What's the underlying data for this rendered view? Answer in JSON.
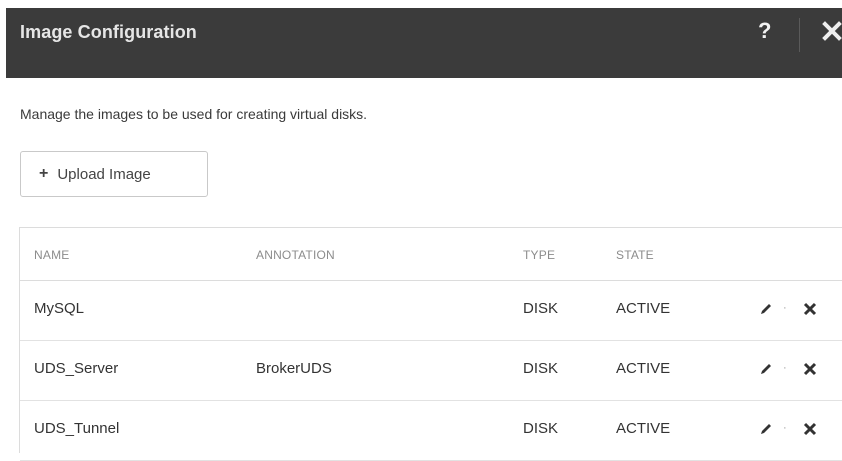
{
  "dialog": {
    "title": "Image Configuration",
    "help_label": "?",
    "description": "Manage the images to be used for creating virtual disks.",
    "upload_button": {
      "icon": "+",
      "label": "Upload Image"
    }
  },
  "table": {
    "headers": [
      "NAME",
      "ANNOTATION",
      "TYPE",
      "STATE"
    ],
    "rows": [
      {
        "name": "MySQL",
        "annotation": "",
        "type": "DISK",
        "state": "ACTIVE"
      },
      {
        "name": "UDS_Server",
        "annotation": "BrokerUDS",
        "type": "DISK",
        "state": "ACTIVE"
      },
      {
        "name": "UDS_Tunnel",
        "annotation": "",
        "type": "DISK",
        "state": "ACTIVE"
      }
    ],
    "action_separator": "·"
  },
  "icons": {
    "help": "help-icon",
    "close": "close-icon",
    "edit": "pencil-icon",
    "delete": "delete-x-icon"
  }
}
